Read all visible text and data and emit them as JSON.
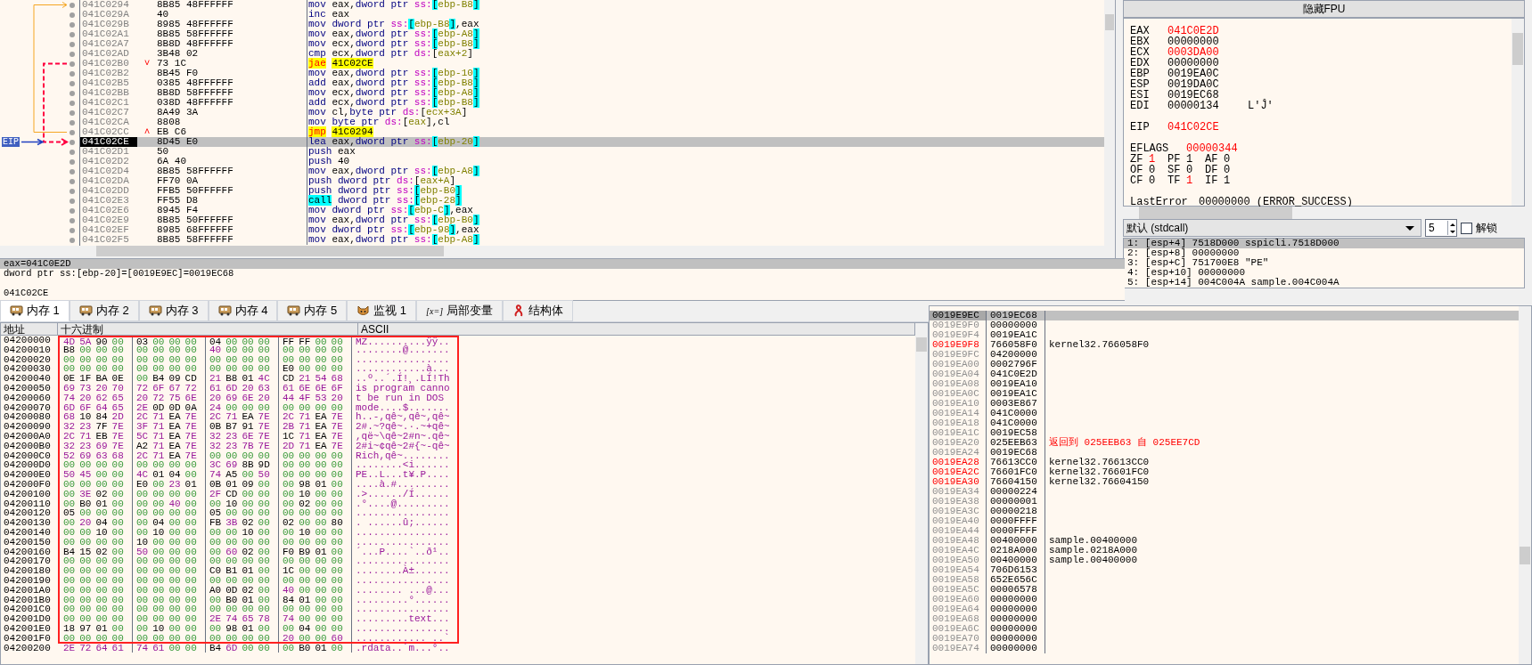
{
  "disassembly": {
    "eip_label": "EIP",
    "rows": [
      {
        "address": "041C0294",
        "bytes": "8B85 48FFFFFF",
        "instruction": "mov eax,dword ptr ss:[ebp-B8]",
        "kind": "normal",
        "selected": false
      },
      {
        "address": "041C029A",
        "bytes": "40",
        "instruction": "inc eax",
        "kind": "normal",
        "selected": false
      },
      {
        "address": "041C029B",
        "bytes": "8985 48FFFFFF",
        "instruction": "mov dword ptr ss:[ebp-B8],eax",
        "kind": "normal",
        "selected": false
      },
      {
        "address": "041C02A1",
        "bytes": "8B85 58FFFFFF",
        "instruction": "mov eax,dword ptr ss:[ebp-A8]",
        "kind": "normal",
        "selected": false
      },
      {
        "address": "041C02A7",
        "bytes": "8B8D 48FFFFFF",
        "instruction": "mov ecx,dword ptr ss:[ebp-B8]",
        "kind": "normal",
        "selected": false
      },
      {
        "address": "041C02AD",
        "bytes": "3B48 02",
        "instruction": "cmp ecx,dword ptr ds:[eax+2]",
        "kind": "normal",
        "selected": false
      },
      {
        "address": "041C02B0",
        "bytes": "73 1C",
        "instruction": "jae 41C02CE",
        "kind": "jump",
        "mark": "˅",
        "selected": false
      },
      {
        "address": "041C02B2",
        "bytes": "8B45 F0",
        "instruction": "mov eax,dword ptr ss:[ebp-10]",
        "kind": "normal",
        "selected": false
      },
      {
        "address": "041C02B5",
        "bytes": "0385 48FFFFFF",
        "instruction": "add eax,dword ptr ss:[ebp-B8]",
        "kind": "normal",
        "selected": false
      },
      {
        "address": "041C02BB",
        "bytes": "8B8D 58FFFFFF",
        "instruction": "mov ecx,dword ptr ss:[ebp-A8]",
        "kind": "normal",
        "selected": false
      },
      {
        "address": "041C02C1",
        "bytes": "038D 48FFFFFF",
        "instruction": "add ecx,dword ptr ss:[ebp-B8]",
        "kind": "normal",
        "selected": false
      },
      {
        "address": "041C02C7",
        "bytes": "8A49 3A",
        "instruction": "mov cl,byte ptr ds:[ecx+3A]",
        "kind": "normal",
        "selected": false
      },
      {
        "address": "041C02CA",
        "bytes": "8808",
        "instruction": "mov byte ptr ds:[eax],cl",
        "kind": "normal",
        "selected": false
      },
      {
        "address": "041C02CC",
        "bytes": "EB C6",
        "instruction": "jmp 41C0294",
        "kind": "jump",
        "mark": "˄",
        "selected": false
      },
      {
        "address": "041C02CE",
        "bytes": "8D45 E0",
        "instruction": "lea eax,dword ptr ss:[ebp-20]",
        "kind": "normal",
        "selected": true
      },
      {
        "address": "041C02D1",
        "bytes": "50",
        "instruction": "push eax",
        "kind": "normal",
        "selected": false
      },
      {
        "address": "041C02D2",
        "bytes": "6A 40",
        "instruction": "push 40",
        "kind": "normal",
        "selected": false
      },
      {
        "address": "041C02D4",
        "bytes": "8B85 58FFFFFF",
        "instruction": "mov eax,dword ptr ss:[ebp-A8]",
        "kind": "normal",
        "selected": false
      },
      {
        "address": "041C02DA",
        "bytes": "FF70 0A",
        "instruction": "push dword ptr ds:[eax+A]",
        "kind": "normal",
        "selected": false
      },
      {
        "address": "041C02DD",
        "bytes": "FFB5 50FFFFFF",
        "instruction": "push dword ptr ss:[ebp-B0]",
        "kind": "normal",
        "selected": false
      },
      {
        "address": "041C02E3",
        "bytes": "FF55 D8",
        "instruction": "call dword ptr ss:[ebp-28]",
        "kind": "call",
        "selected": false
      },
      {
        "address": "041C02E6",
        "bytes": "8945 F4",
        "instruction": "mov dword ptr ss:[ebp-C],eax",
        "kind": "normal",
        "selected": false
      },
      {
        "address": "041C02E9",
        "bytes": "8B85 50FFFFFF",
        "instruction": "mov eax,dword ptr ss:[ebp-B0]",
        "kind": "normal",
        "selected": false
      },
      {
        "address": "041C02EF",
        "bytes": "8985 68FFFFFF",
        "instruction": "mov dword ptr ss:[ebp-98],eax",
        "kind": "normal",
        "selected": false
      },
      {
        "address": "041C02F5",
        "bytes": "8B85 58FFFFFF",
        "instruction": "mov eax,dword ptr ss:[ebp-A8]",
        "kind": "normal",
        "selected": false
      }
    ]
  },
  "registers": {
    "header": "隐藏FPU",
    "general": [
      {
        "name": "EAX",
        "value": "041C0E2D",
        "changed": true
      },
      {
        "name": "EBX",
        "value": "00000000",
        "changed": false
      },
      {
        "name": "ECX",
        "value": "0003DA00",
        "changed": true
      },
      {
        "name": "EDX",
        "value": "00000000",
        "changed": false
      },
      {
        "name": "EBP",
        "value": "0019EA0C",
        "changed": false
      },
      {
        "name": "ESP",
        "value": "0019DA0C",
        "changed": false
      },
      {
        "name": "ESI",
        "value": "0019EC68",
        "changed": false
      },
      {
        "name": "EDI",
        "value": "00000134",
        "changed": false,
        "comment": "L'Ĵ'"
      }
    ],
    "eip": {
      "name": "EIP",
      "value": "041C02CE",
      "changed": true
    },
    "eflags": {
      "name": "EFLAGS",
      "value": "00000344",
      "changed": true
    },
    "flags": [
      [
        {
          "name": "ZF",
          "value": "1",
          "changed": true
        },
        {
          "name": "PF",
          "value": "1",
          "changed": false
        },
        {
          "name": "AF",
          "value": "0",
          "changed": false
        }
      ],
      [
        {
          "name": "OF",
          "value": "0",
          "changed": false
        },
        {
          "name": "SF",
          "value": "0",
          "changed": false
        },
        {
          "name": "DF",
          "value": "0",
          "changed": false
        }
      ],
      [
        {
          "name": "CF",
          "value": "0",
          "changed": false
        },
        {
          "name": "TF",
          "value": "1",
          "changed": true
        },
        {
          "name": "IF",
          "value": "1",
          "changed": false
        }
      ]
    ],
    "last_error": {
      "name": "LastError",
      "value": "00000000 (ERROR_SUCCESS)"
    }
  },
  "call_args": {
    "convention": "默认 (stdcall)",
    "count": "5",
    "unlock": {
      "label": "解锁",
      "checked": false
    },
    "args": [
      {
        "text": "1: [esp+4] 7518D000 sspicli.7518D000",
        "selected": true
      },
      {
        "text": "2: [esp+8] 00000000",
        "selected": false
      },
      {
        "text": "3: [esp+C] 751700E8 \"PE\"",
        "selected": false
      },
      {
        "text": "4: [esp+10] 00000000",
        "selected": false
      },
      {
        "text": "5: [esp+14] 004C004A sample.004C004A",
        "selected": false
      }
    ]
  },
  "info_pane": {
    "lines": [
      {
        "text": "eax=041C0E2D",
        "selected": true
      },
      {
        "text": "dword ptr ss:[ebp-20]=[0019E9EC]=0019EC68",
        "selected": false
      }
    ],
    "address": "041C02CE"
  },
  "tabs": [
    {
      "label": "内存 1",
      "kind": "memory",
      "selected": true
    },
    {
      "label": "内存 2",
      "kind": "memory",
      "selected": false
    },
    {
      "label": "内存 3",
      "kind": "memory",
      "selected": false
    },
    {
      "label": "内存 4",
      "kind": "memory",
      "selected": false
    },
    {
      "label": "内存 5",
      "kind": "memory",
      "selected": false
    },
    {
      "label": "监视 1",
      "kind": "watch",
      "selected": false
    },
    {
      "label": "局部变量",
      "kind": "locals",
      "icon_text": "[x=]",
      "selected": false
    },
    {
      "label": "结构体",
      "kind": "struct",
      "selected": false
    }
  ],
  "hex_dump": {
    "columns": [
      "地址",
      "十六进制",
      "ASCII"
    ],
    "rows": [
      {
        "address": "04200000",
        "bytes": "4D 5A 90 00 03 00 00 00 04 00 00 00 FF FF 00 00",
        "ascii": "MZ..........ÿÿ..",
        "selected": true
      },
      {
        "address": "04200010",
        "bytes": "B8 00 00 00 00 00 00 00 40 00 00 00 00 00 00 00",
        "ascii": "........@.......",
        "selected": true
      },
      {
        "address": "04200020",
        "bytes": "00 00 00 00 00 00 00 00 00 00 00 00 00 00 00 00",
        "ascii": "................",
        "selected": true
      },
      {
        "address": "04200030",
        "bytes": "00 00 00 00 00 00 00 00 00 00 00 00 E0 00 00 00",
        "ascii": "............à...",
        "selected": true
      },
      {
        "address": "04200040",
        "bytes": "0E 1F BA 0E 00 B4 09 CD 21 B8 01 4C CD 21 54 68",
        "ascii": "..º..´.Í!¸.LÍ!Th",
        "selected": true
      },
      {
        "address": "04200050",
        "bytes": "69 73 20 70 72 6F 67 72 61 6D 20 63 61 6E 6E 6F",
        "ascii": "is program canno",
        "selected": true
      },
      {
        "address": "04200060",
        "bytes": "74 20 62 65 20 72 75 6E 20 69 6E 20 44 4F 53 20",
        "ascii": "t be run in DOS ",
        "selected": true
      },
      {
        "address": "04200070",
        "bytes": "6D 6F 64 65 2E 0D 0D 0A 24 00 00 00 00 00 00 00",
        "ascii": "mode....$.......",
        "selected": true
      },
      {
        "address": "04200080",
        "bytes": "68 10 84 2D 2C 71 EA 7E 2C 71 EA 7E 2C 71 EA 7E",
        "ascii": "h..-,qê~,qê~,qê~",
        "selected": true
      },
      {
        "address": "04200090",
        "bytes": "32 23 7F 7E 3F 71 EA 7E 0B B7 91 7E 2B 71 EA 7E",
        "ascii": "2#.~?qê~.·.~+qê~",
        "selected": true
      },
      {
        "address": "042000A0",
        "bytes": "2C 71 EB 7E 5C 71 EA 7E 32 23 6E 7E 1C 71 EA 7E",
        "ascii": ",që~\\qê~2#n~.qê~",
        "selected": true
      },
      {
        "address": "042000B0",
        "bytes": "32 23 69 7E A2 71 EA 7E 32 23 7B 7E 2D 71 EA 7E",
        "ascii": "2#i~¢qê~2#{~-qê~",
        "selected": true
      },
      {
        "address": "042000C0",
        "bytes": "52 69 63 68 2C 71 EA 7E 00 00 00 00 00 00 00 00",
        "ascii": "Rich,qê~........",
        "selected": true
      },
      {
        "address": "042000D0",
        "bytes": "00 00 00 00 00 00 00 00 3C 69 8B 9D 00 00 00 00",
        "ascii": "........<i......",
        "selected": true
      },
      {
        "address": "042000E0",
        "bytes": "50 45 00 00 4C 01 04 00 74 A5 00 50 00 00 00 00",
        "ascii": "PE..L...t¥.P....",
        "selected": true
      },
      {
        "address": "042000F0",
        "bytes": "00 00 00 00 E0 00 23 01 0B 01 09 00 00 98 01 00",
        "ascii": "....à.#.........",
        "selected": true
      },
      {
        "address": "04200100",
        "bytes": "00 3E 02 00 00 00 00 00 2F CD 00 00 00 10 00 00",
        "ascii": ".>....../Í......",
        "selected": true
      },
      {
        "address": "04200110",
        "bytes": "00 B0 01 00 00 00 40 00 00 10 00 00 00 02 00 00",
        "ascii": ".°....@.........",
        "selected": true
      },
      {
        "address": "04200120",
        "bytes": "05 00 00 00 00 00 00 00 05 00 00 00 00 00 00 00",
        "ascii": "................",
        "selected": true
      },
      {
        "address": "04200130",
        "bytes": "00 20 04 00 00 04 00 00 FB 3B 02 00 02 00 00 80",
        "ascii": ". ......û;......",
        "selected": true
      },
      {
        "address": "04200140",
        "bytes": "00 00 10 00 00 10 00 00 00 00 10 00 00 10 00 00",
        "ascii": "................",
        "selected": true
      },
      {
        "address": "04200150",
        "bytes": "00 00 00 00 10 00 00 00 00 00 00 00 00 00 00 00",
        "ascii": "................",
        "selected": true
      },
      {
        "address": "04200160",
        "bytes": "B4 15 02 00 50 00 00 00 00 60 02 00 F0 B9 01 00",
        "ascii": "´...P....`..ð¹..",
        "selected": true
      },
      {
        "address": "04200170",
        "bytes": "00 00 00 00 00 00 00 00 00 00 00 00 00 00 00 00",
        "ascii": "................",
        "selected": true
      },
      {
        "address": "04200180",
        "bytes": "00 00 00 00 00 00 00 00 C0 B1 01 00 1C 00 00 00",
        "ascii": "........À±......",
        "selected": true
      },
      {
        "address": "04200190",
        "bytes": "00 00 00 00 00 00 00 00 00 00 00 00 00 00 00 00",
        "ascii": "................",
        "selected": true
      },
      {
        "address": "042001A0",
        "bytes": "00 00 00 00 00 00 00 00 A0 0D 02 00 40 00 00 00",
        "ascii": "........ ...@...",
        "selected": true
      },
      {
        "address": "042001B0",
        "bytes": "00 00 00 00 00 00 00 00 00 B0 01 00 84 01 00 00",
        "ascii": ".........°......",
        "selected": true
      },
      {
        "address": "042001C0",
        "bytes": "00 00 00 00 00 00 00 00 00 00 00 00 00 00 00 00",
        "ascii": "................",
        "selected": true
      },
      {
        "address": "042001D0",
        "bytes": "00 00 00 00 00 00 00 00 2E 74 65 78 74 00 00 00",
        "ascii": ".........text...",
        "selected": true
      },
      {
        "address": "042001E0",
        "bytes": "18 97 01 00 00 10 00 00 00 98 01 00 00 04 00 00",
        "ascii": "................",
        "selected": true
      },
      {
        "address": "042001F0",
        "bytes": "00 00 00 00 00 00 00 00 00 00 00 00 20 00 00 60",
        "ascii": "............ ..`",
        "selected": true
      },
      {
        "address": "04200200",
        "bytes": "2E 72 64 61 74 61 00 00 B4 6D 00 00 00 B0 01 00",
        "ascii": ".rdata..´m...°..",
        "selected": false
      }
    ]
  },
  "stack": {
    "rows": [
      {
        "address": "0019E9EC",
        "value": "0019EC68",
        "selected": true,
        "highlight": false
      },
      {
        "address": "0019E9F0",
        "value": "00000000",
        "selected": false,
        "highlight": false
      },
      {
        "address": "0019E9F4",
        "value": "0019EA1C",
        "selected": false,
        "highlight": false
      },
      {
        "address": "0019E9F8",
        "value": "766058F0",
        "comment": "kernel32.766058F0",
        "selected": false,
        "highlight": true
      },
      {
        "address": "0019E9FC",
        "value": "04200000",
        "selected": false,
        "highlight": false
      },
      {
        "address": "0019EA00",
        "value": "0002796F",
        "selected": false,
        "highlight": false
      },
      {
        "address": "0019EA04",
        "value": "041C0E2D",
        "selected": false,
        "highlight": false
      },
      {
        "address": "0019EA08",
        "value": "0019EA10",
        "selected": false,
        "highlight": false
      },
      {
        "address": "0019EA0C",
        "value": "0019EA1C",
        "selected": false,
        "highlight": false
      },
      {
        "address": "0019EA10",
        "value": "0003E867",
        "selected": false,
        "highlight": false
      },
      {
        "address": "0019EA14",
        "value": "041C0000",
        "selected": false,
        "highlight": false
      },
      {
        "address": "0019EA18",
        "value": "041C0000",
        "selected": false,
        "highlight": false
      },
      {
        "address": "0019EA1C",
        "value": "0019EC58",
        "selected": false,
        "highlight": false
      },
      {
        "address": "0019EA20",
        "value": "025EEB63",
        "comment": "返回到 025EEB63 自 025EE7CD",
        "kind": "return",
        "selected": false,
        "highlight": false
      },
      {
        "address": "0019EA24",
        "value": "0019EC68",
        "selected": false,
        "highlight": false
      },
      {
        "address": "0019EA28",
        "value": "76613CC0",
        "comment": "kernel32.76613CC0",
        "selected": false,
        "highlight": true
      },
      {
        "address": "0019EA2C",
        "value": "76601FC0",
        "comment": "kernel32.76601FC0",
        "selected": false,
        "highlight": true
      },
      {
        "address": "0019EA30",
        "value": "76604150",
        "comment": "kernel32.76604150",
        "selected": false,
        "highlight": true
      },
      {
        "address": "0019EA34",
        "value": "00000224",
        "selected": false,
        "highlight": false
      },
      {
        "address": "0019EA38",
        "value": "00000001",
        "selected": false,
        "highlight": false
      },
      {
        "address": "0019EA3C",
        "value": "00000218",
        "selected": false,
        "highlight": false
      },
      {
        "address": "0019EA40",
        "value": "0000FFFF",
        "selected": false,
        "highlight": false
      },
      {
        "address": "0019EA44",
        "value": "0000FFFF",
        "selected": false,
        "highlight": false
      },
      {
        "address": "0019EA48",
        "value": "00400000",
        "comment": "sample.00400000",
        "selected": false,
        "highlight": false
      },
      {
        "address": "0019EA4C",
        "value": "0218A000",
        "comment": "sample.0218A000",
        "selected": false,
        "highlight": false
      },
      {
        "address": "0019EA50",
        "value": "00400000",
        "comment": "sample.00400000",
        "selected": false,
        "highlight": false
      },
      {
        "address": "0019EA54",
        "value": "706D6153",
        "selected": false,
        "highlight": false
      },
      {
        "address": "0019EA58",
        "value": "652E656C",
        "selected": false,
        "highlight": false
      },
      {
        "address": "0019EA5C",
        "value": "00006578",
        "selected": false,
        "highlight": false
      },
      {
        "address": "0019EA60",
        "value": "00000000",
        "selected": false,
        "highlight": false
      },
      {
        "address": "0019EA64",
        "value": "00000000",
        "selected": false,
        "highlight": false
      },
      {
        "address": "0019EA68",
        "value": "00000000",
        "selected": false,
        "highlight": false
      },
      {
        "address": "0019EA6C",
        "value": "00000000",
        "selected": false,
        "highlight": false
      },
      {
        "address": "0019EA70",
        "value": "00000000",
        "selected": false,
        "highlight": false
      },
      {
        "address": "0019EA74",
        "value": "00000000",
        "selected": false,
        "highlight": false
      }
    ]
  }
}
